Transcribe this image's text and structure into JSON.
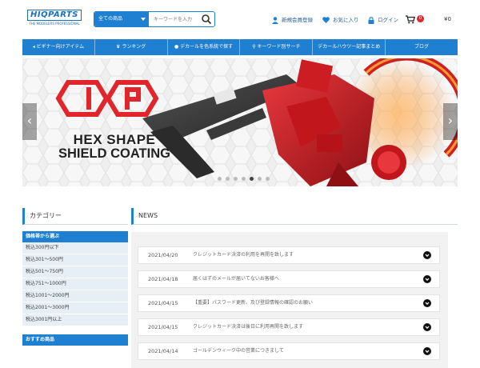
{
  "header": {
    "logo": "HIQPARTS",
    "logo_sub": "THE MODELERS PROFESSIONAL",
    "search": {
      "category": "全ての商品",
      "placeholder": "キーワードを入力"
    },
    "links": {
      "register": "新規会員登録",
      "favorites": "お気に入り",
      "login": "ログイン"
    },
    "cart": {
      "count": "0",
      "total": "¥0"
    }
  },
  "nav": [
    "ビギナー向けアイテム",
    "ランキング",
    "デカールを色系統で探す",
    "キーワード別サーチ",
    "デカールハウツー記事まとめ",
    "ブログ"
  ],
  "hero": {
    "logo_text": "HP",
    "line1": "HEX SHAPE",
    "line2": "SHIELD COATING",
    "accent": "#e0252b",
    "active_slide": 5,
    "slide_count": 7
  },
  "sidebar": {
    "title": "カテゴリー",
    "sections": [
      {
        "heading": "価格帯から選ぶ",
        "items": [
          "税込300円以下",
          "税込301〜500円",
          "税込501〜750円",
          "税込751〜1000円",
          "税込1001〜2000円",
          "税込2001〜3000円",
          "税込3001円以上"
        ]
      },
      {
        "heading": "おすすめ商品",
        "items": []
      }
    ]
  },
  "news": {
    "title": "NEWS",
    "items": [
      {
        "date": "2021/04/20",
        "text": "クレジットカード決済の利用を再開を致します"
      },
      {
        "date": "2021/04/18",
        "text": "届くはずのメールが届いてないお客様へ"
      },
      {
        "date": "2021/04/15",
        "text": "【重要】パスワード更新、及び登録情報の確認のお願い"
      },
      {
        "date": "2021/04/15",
        "text": "クレジットカード決済は後日に利用再開を致します"
      },
      {
        "date": "2021/04/14",
        "text": "ゴールデンウィーク中の営業につきまして"
      }
    ]
  },
  "colors": {
    "primary": "#1f7fd1",
    "accent": "#e0252b"
  }
}
